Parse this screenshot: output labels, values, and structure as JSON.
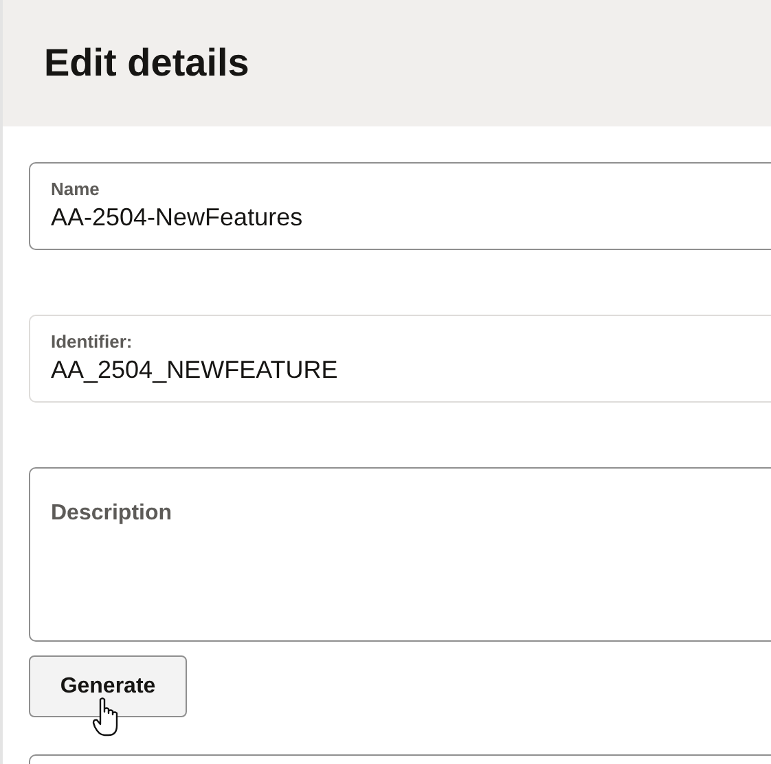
{
  "header": {
    "title": "Edit details"
  },
  "fields": [
    {
      "kind": "text",
      "label": "Name",
      "value": "AA-2504-NewFeatures"
    },
    {
      "kind": "readonly",
      "label": "Identifier:",
      "value": "AA_2504_NEWFEATURE"
    },
    {
      "kind": "textarea",
      "placeholder": "Description"
    }
  ],
  "generate_button": {
    "label": "Generate"
  },
  "next_field": {
    "kind": "text"
  }
}
